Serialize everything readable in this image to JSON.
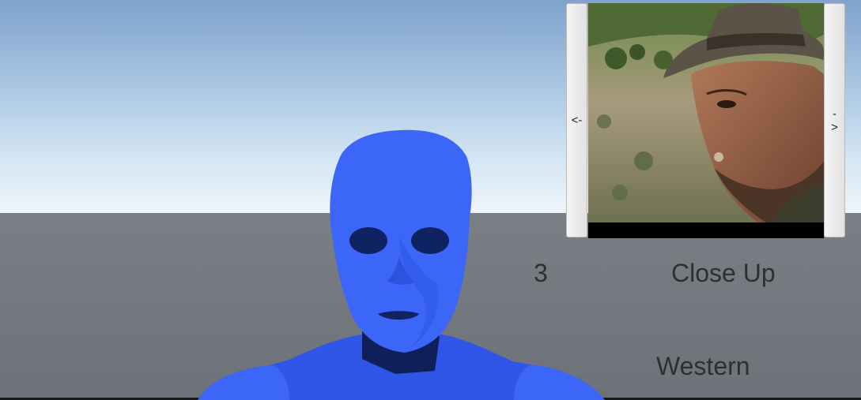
{
  "shot_selector": {
    "prev_label": "<-",
    "next_label": "->",
    "preview_subject": "western-film-closeup-still"
  },
  "shot": {
    "index": "3",
    "type": "Close Up"
  },
  "genre": "Western",
  "scene": {
    "character": "blue-mannequin",
    "sky_color": "#a9c6e3",
    "ground_color": "#71767c",
    "mannequin_color": "#3a63f2"
  }
}
